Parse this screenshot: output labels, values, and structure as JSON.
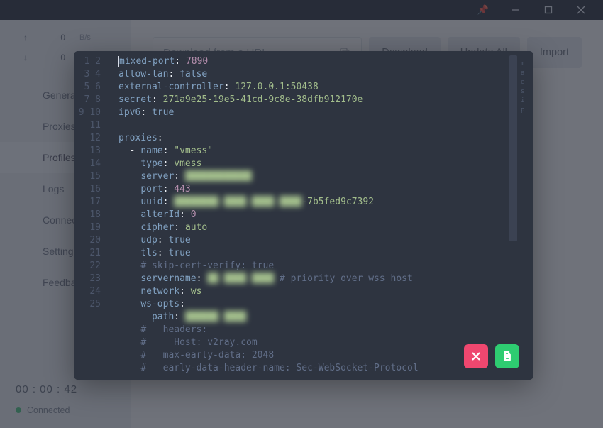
{
  "titlebar": {
    "pin": "📌"
  },
  "netstats": {
    "up": {
      "arrow": "↑",
      "value": "0",
      "unit": "B/s"
    },
    "down": {
      "arrow": "↓",
      "value": "0",
      "unit": ""
    }
  },
  "nav": {
    "items": [
      {
        "label": "General"
      },
      {
        "label": "Proxies"
      },
      {
        "label": "Profiles"
      },
      {
        "label": "Logs"
      },
      {
        "label": "Connections"
      },
      {
        "label": "Settings"
      },
      {
        "label": "Feedback"
      }
    ],
    "active_index": 2
  },
  "status": {
    "clock": "00 : 00 : 42",
    "state": "Connected"
  },
  "toolbar": {
    "url_placeholder": "Download from a URL",
    "download": "Download",
    "update_all": "Update All",
    "import": "Import"
  },
  "editor": {
    "line_count": 25,
    "minimap_chars": [
      "m",
      "a",
      "e",
      "s",
      "i",
      "p"
    ],
    "yaml": {
      "mixed_port": 7890,
      "allow_lan": false,
      "external_controller": "127.0.0.1:50438",
      "secret": "271a9e25-19e5-41cd-9c8e-38dfb912170e",
      "ipv6": true,
      "proxies_key": "proxies",
      "proxy": {
        "name": "\"vmess\"",
        "type": "vmess",
        "server_masked": "████████████",
        "port": 443,
        "uuid_masked": "████████-████-████-████",
        "uuid_tail": "-7b5fed9c7392",
        "alterId": 0,
        "cipher": "auto",
        "udp": true,
        "tls": true,
        "skip_cert_comment": "# skip-cert-verify: true",
        "servername_masked": "██ ████ ████",
        "servername_comment": "# priority over wss host",
        "network": "ws",
        "ws_opts_key": "ws-opts",
        "path_masked": "██████ ████",
        "trailing_comments": [
          "#   headers:",
          "#     Host: v2ray.com",
          "#   max-early-data: 2048",
          "#   early-data-header-name: Sec-WebSocket-Protocol"
        ]
      }
    }
  }
}
